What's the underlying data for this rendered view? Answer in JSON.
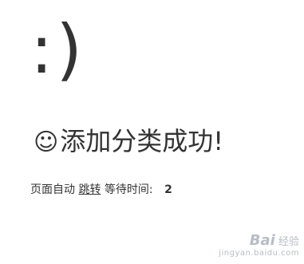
{
  "smiley": ":)",
  "headline": {
    "icon": "☺",
    "text": "添加分类成功!"
  },
  "jump": {
    "prefix": "页面自动",
    "link_label": "跳转",
    "wait_label": "等待时间:",
    "seconds": "2"
  },
  "watermark": {
    "brand": "Bai",
    "brand_suffix": "经验",
    "url": "jingyan.baidu.com"
  }
}
